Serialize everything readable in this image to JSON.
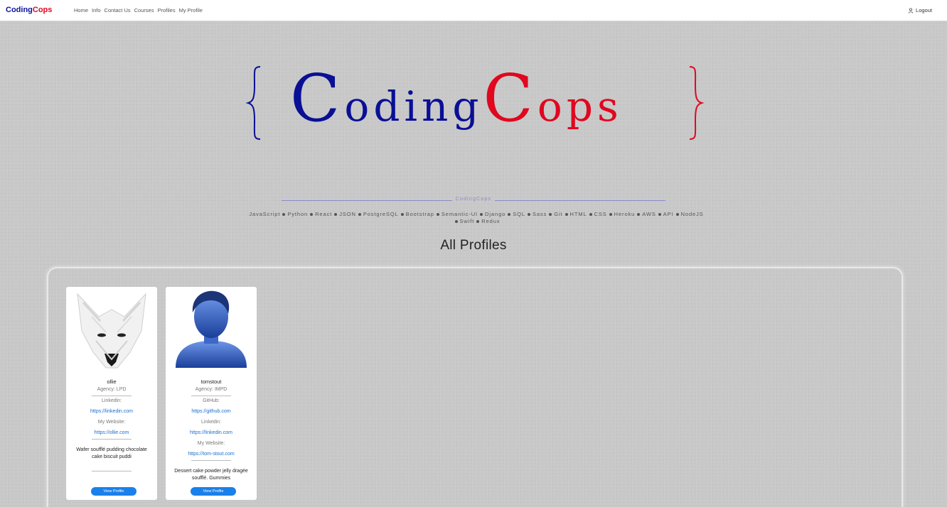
{
  "navbar": {
    "brand_part1": "Coding",
    "brand_part2": "Cops",
    "links": [
      "Home",
      "Info",
      "Contact Us",
      "Courses",
      "Profiles",
      "My Profile"
    ],
    "logout": "Logout",
    "logout_icon": "user-icon"
  },
  "hero": {
    "logo_coding_initial": "C",
    "logo_coding_rest": "oding",
    "logo_cops_initial": "C",
    "logo_cops_rest": "ops",
    "brace_left_icon": "left-brace",
    "brace_right_icon": "right-brace",
    "colors": {
      "blue": "#0a0f95",
      "red": "#e0071f"
    }
  },
  "divider_label": "CodingCops",
  "skills": [
    "JavaScript",
    "Python",
    "React",
    "JSON",
    "PostgreSQL",
    "Bootstrap",
    "Semantic-UI",
    "Django",
    "SQL",
    "Sass",
    "Git",
    "HTML",
    "CSS",
    "Heroku",
    "AWS",
    "API",
    "NodeJS",
    "Swift",
    "Redux"
  ],
  "page_title": "All Profiles",
  "profiles": [
    {
      "username": "ollie",
      "agency": "Agency: LPD",
      "avatar_icon": "white-wolf-avatar",
      "fields": [
        {
          "label": "Linkedin:",
          "link": "https://linkedin.com"
        },
        {
          "label": "My Website:",
          "link": "https://ollie.com"
        }
      ],
      "bio": "Wafer soufflé pudding chocolate cake biscuit puddi",
      "button": "View Profile"
    },
    {
      "username": "tomstout",
      "agency": "Agency: IMPD",
      "avatar_icon": "blue-person-avatar",
      "fields": [
        {
          "label": "GitHub:",
          "link": "https://github.com"
        },
        {
          "label": "Linkedin:",
          "link": "https://linkedin.com"
        },
        {
          "label": "My Website:",
          "link": "https://tom-stout.com"
        }
      ],
      "bio": "Dessert cake powder jelly dragée soufflé. Gummies",
      "button": "View Profile"
    }
  ]
}
